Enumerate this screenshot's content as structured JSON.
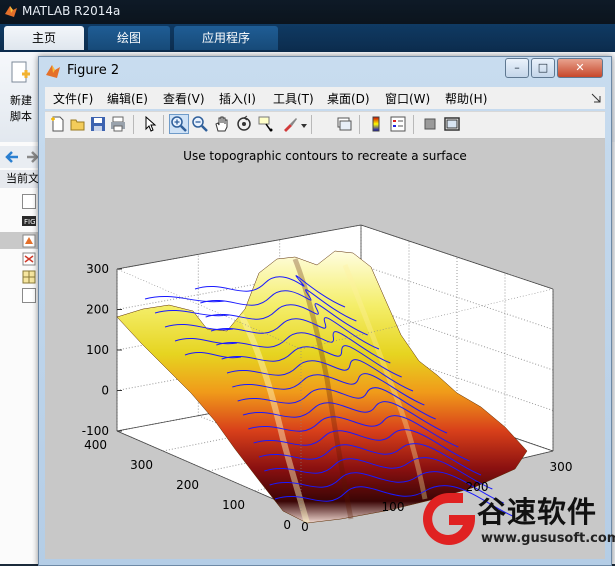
{
  "app": {
    "title": "MATLAB R2014a"
  },
  "main_tabs": [
    {
      "label": "主页"
    },
    {
      "label": "绘图"
    },
    {
      "label": "应用程序"
    }
  ],
  "ribbon": {
    "new_script_line1": "新建",
    "new_script_line2": "脚本"
  },
  "current_folder_label": "当前文",
  "figure": {
    "title": "Figure 2",
    "window_buttons": [
      "–",
      "□",
      "✕"
    ],
    "menus": [
      "文件(F)",
      "编辑(E)",
      "查看(V)",
      "插入(I)",
      "工具(T)",
      "桌面(D)",
      "窗口(W)",
      "帮助(H)"
    ],
    "toolbar_icons": [
      "new-figure-icon",
      "open-icon",
      "save-icon",
      "print-icon",
      "pointer-icon",
      "zoom-in-icon",
      "zoom-out-icon",
      "pan-icon",
      "rotate-3d-icon",
      "data-cursor-icon",
      "brush-icon",
      "link-plot-icon",
      "colorbar-icon",
      "legend-icon",
      "hide-plot-tools-icon",
      "show-plot-tools-icon"
    ],
    "plot_title": "Use topographic contours to recreate a surface"
  },
  "chart_data": {
    "type": "surface",
    "title": "Use topographic contours to recreate a surface",
    "z_ticks": [
      "300",
      "200",
      "100",
      "0",
      "-100"
    ],
    "x_ticks": [
      "0",
      "100",
      "200",
      "300"
    ],
    "y_ticks": [
      "0",
      "100",
      "200",
      "300",
      "400"
    ],
    "zlim": [
      -100,
      300
    ],
    "xlim": [
      0,
      300
    ],
    "ylim": [
      0,
      400
    ],
    "grid": true,
    "colormap": "hot",
    "contour_color": "#1a1aff"
  },
  "watermark": {
    "brand": "谷速软件",
    "url": "www.gususoft.com",
    "color": "#e02222"
  }
}
